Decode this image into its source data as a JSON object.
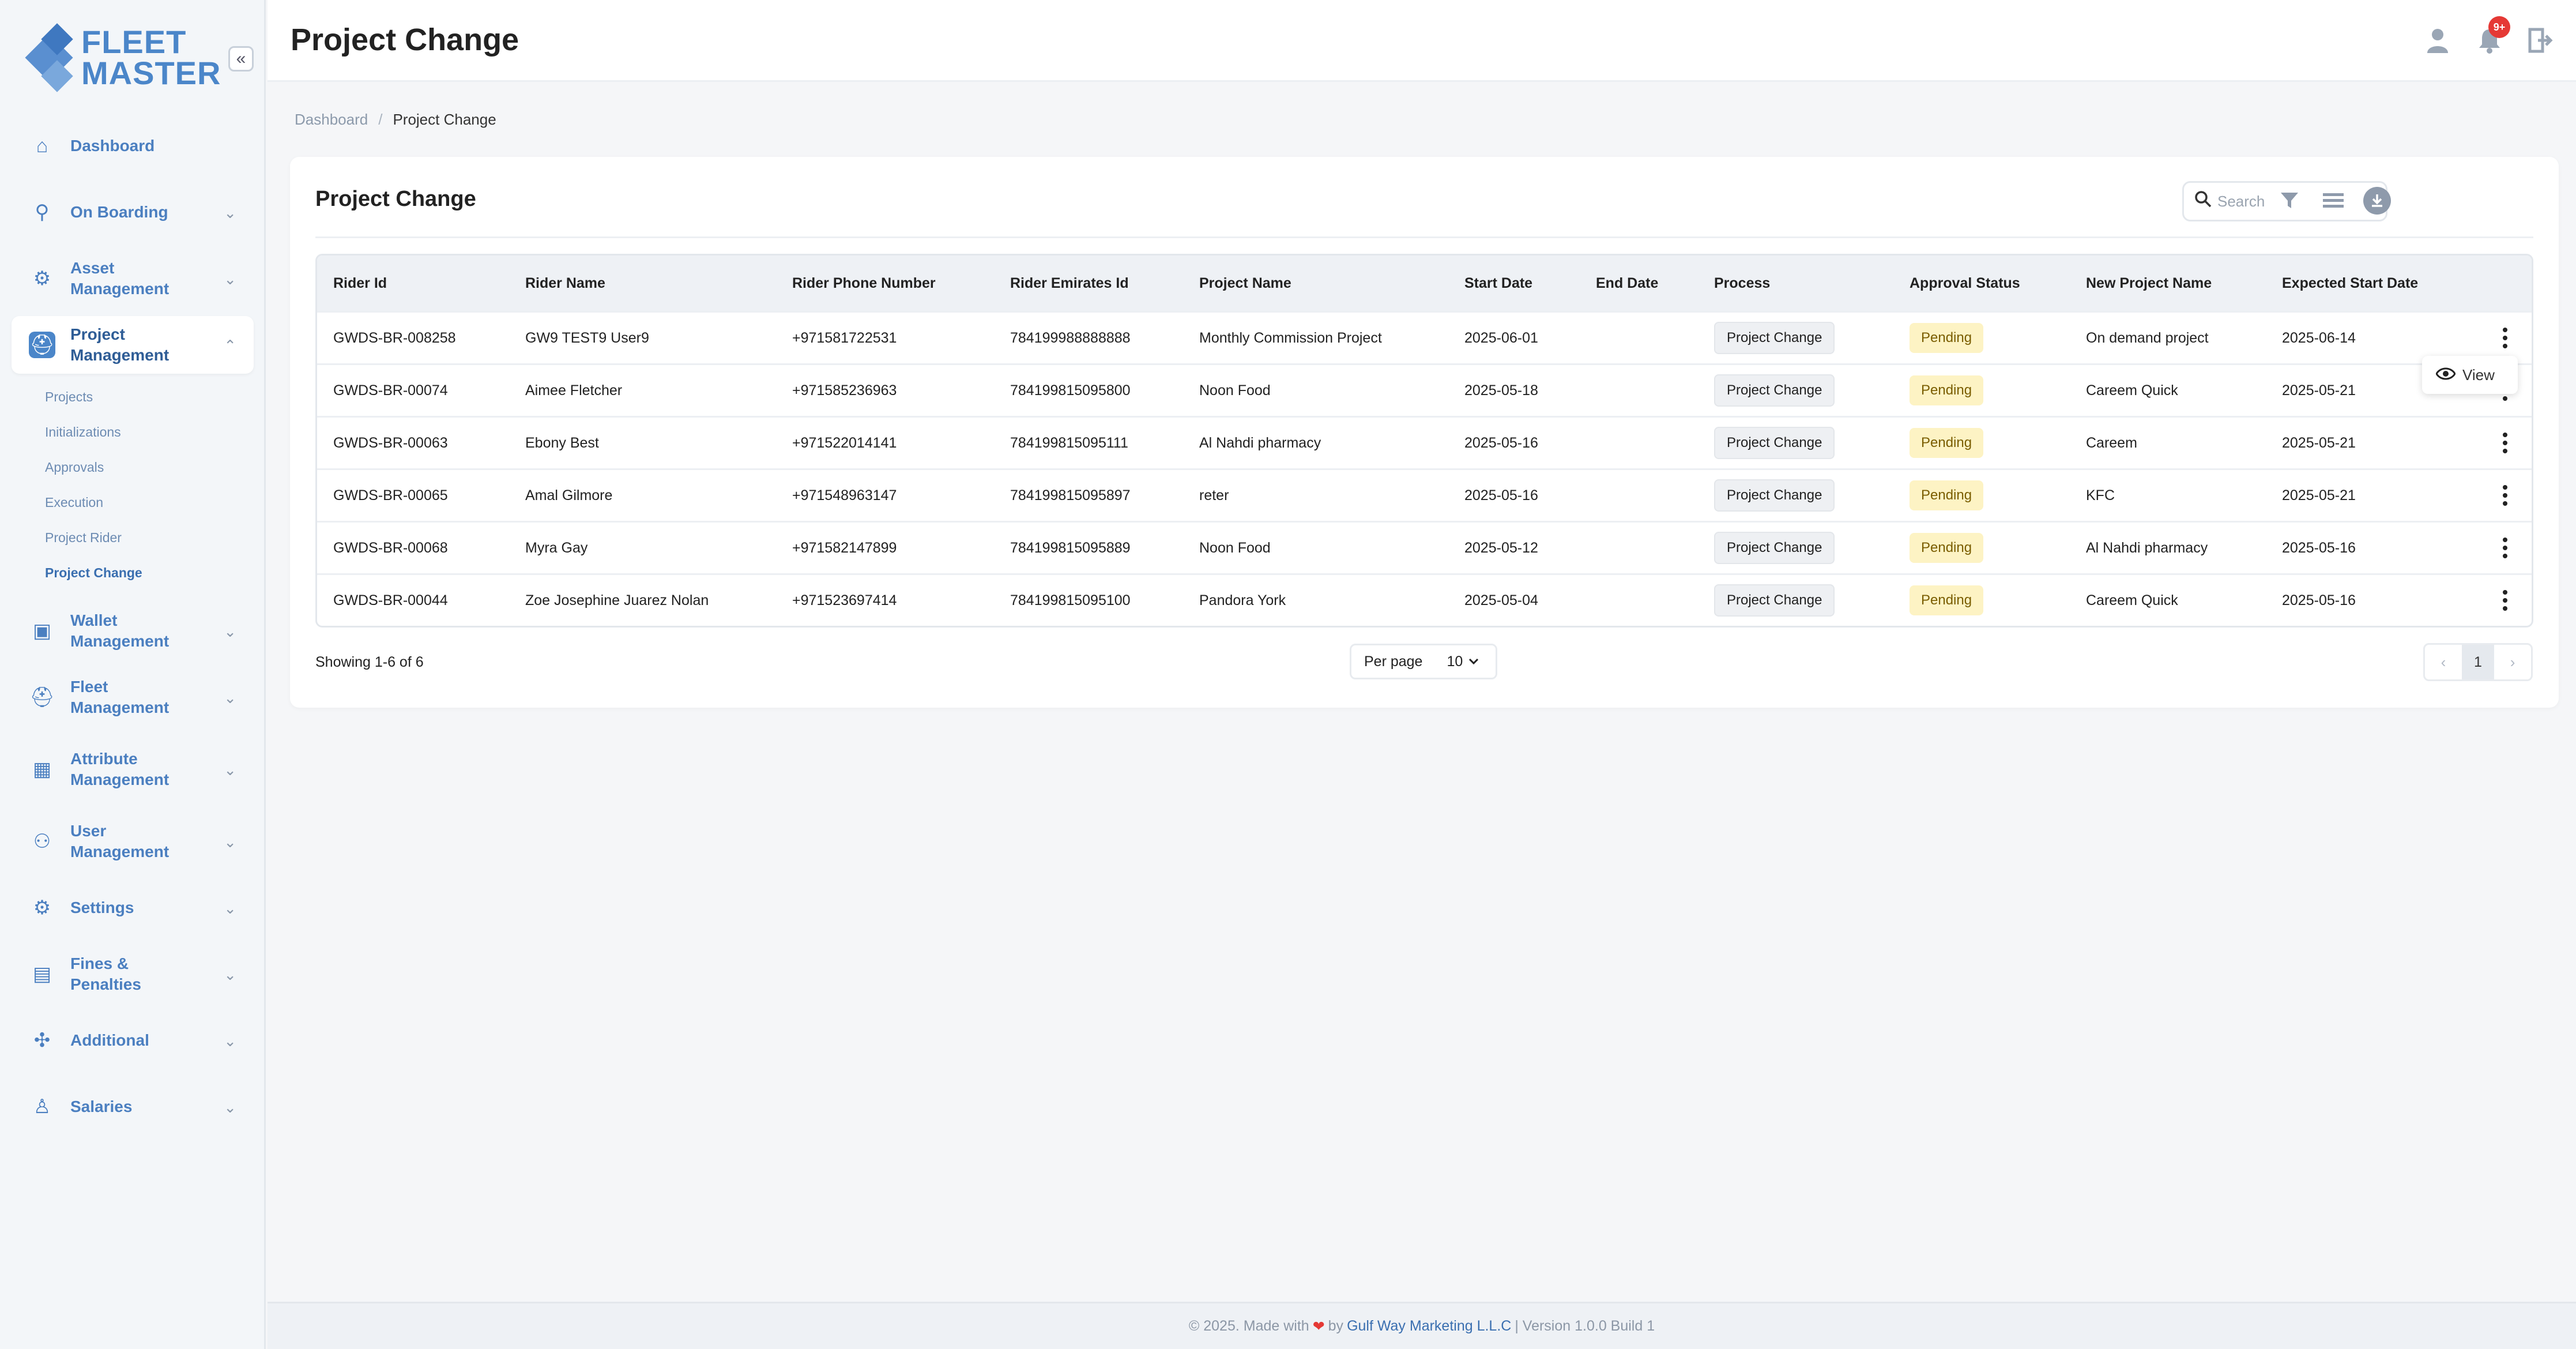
{
  "brand": {
    "line1": "FLEET",
    "line2": "MASTER",
    "collapse_icon": "«"
  },
  "sidebar": {
    "items": [
      {
        "label": "Dashboard",
        "icon": "home-icon",
        "glyph": "⌂",
        "chevron": ""
      },
      {
        "label": "On Boarding",
        "icon": "onboarding-icon",
        "glyph": "⚲",
        "chevron": "⌄"
      },
      {
        "label": "Asset Management",
        "icon": "asset-icon",
        "glyph": "⚙",
        "chevron": "⌄"
      },
      {
        "label": "Project Management",
        "icon": "project-icon",
        "glyph": "⛑",
        "chevron": "⌃"
      },
      {
        "label": "Wallet Management",
        "icon": "wallet-icon",
        "glyph": "▣",
        "chevron": "⌄"
      },
      {
        "label": "Fleet Management",
        "icon": "fleet-icon",
        "glyph": "⛑",
        "chevron": "⌄"
      },
      {
        "label": "Attribute Management",
        "icon": "attribute-icon",
        "glyph": "▦",
        "chevron": "⌄"
      },
      {
        "label": "User Management",
        "icon": "users-icon",
        "glyph": "⚇",
        "chevron": "⌄"
      },
      {
        "label": "Settings",
        "icon": "settings-icon",
        "glyph": "⚙",
        "chevron": "⌄"
      },
      {
        "label": "Fines & Penalties",
        "icon": "fines-icon",
        "glyph": "▤",
        "chevron": "⌄"
      },
      {
        "label": "Additional",
        "icon": "additional-icon",
        "glyph": "✣",
        "chevron": "⌄"
      },
      {
        "label": "Salaries",
        "icon": "salaries-icon",
        "glyph": "♙",
        "chevron": "⌄"
      }
    ],
    "submenu": [
      "Projects",
      "Initializations",
      "Approvals",
      "Execution",
      "Project Rider",
      "Project Change"
    ]
  },
  "header": {
    "title": "Project Change",
    "notification_badge": "9+",
    "user_icon": "user-icon",
    "bell_icon": "bell-icon",
    "logout_icon": "logout-icon"
  },
  "breadcrumb": {
    "home": "Dashboard",
    "separator": "/",
    "current": "Project Change"
  },
  "card": {
    "title": "Project Change",
    "search_placeholder": "Search",
    "search_glyph": "⚲",
    "filter_glyph": "⛛",
    "columns_glyph": "☰",
    "download_glyph": "⤓"
  },
  "table": {
    "columns": [
      "Rider Id",
      "Rider Name",
      "Rider Phone Number",
      "Rider Emirates Id",
      "Project Name",
      "Start Date",
      "End Date",
      "Process",
      "Approval Status",
      "New Project Name",
      "Expected Start Date"
    ],
    "rows": [
      [
        "GWDS-BR-008258",
        "GW9 TEST9 User9",
        "+971581722531",
        "784199988888888",
        "Monthly Commission Project",
        "2025-06-01",
        "",
        "Project Change",
        "Pending",
        "On demand project",
        "2025-06-14"
      ],
      [
        "GWDS-BR-00074",
        "Aimee Fletcher",
        "+971585236963",
        "784199815095800",
        "Noon Food",
        "2025-05-18",
        "",
        "Project Change",
        "Pending",
        "Careem Quick",
        "2025-05-21"
      ],
      [
        "GWDS-BR-00063",
        "Ebony Best",
        "+971522014141",
        "784199815095111",
        "Al Nahdi pharmacy",
        "2025-05-16",
        "",
        "Project Change",
        "Pending",
        "Careem",
        "2025-05-21"
      ],
      [
        "GWDS-BR-00065",
        "Amal Gilmore",
        "+971548963147",
        "784199815095897",
        "reter",
        "2025-05-16",
        "",
        "Project Change",
        "Pending",
        "KFC",
        "2025-05-21"
      ],
      [
        "GWDS-BR-00068",
        "Myra Gay",
        "+971582147899",
        "784199815095889",
        "Noon Food",
        "2025-05-12",
        "",
        "Project Change",
        "Pending",
        "Al Nahdi pharmacy",
        "2025-05-16"
      ],
      [
        "GWDS-BR-00044",
        "Zoe Josephine Juarez Nolan",
        "+971523697414",
        "784199815095100",
        "Pandora York",
        "2025-05-04",
        "",
        "Project Change",
        "Pending",
        "Careem Quick",
        "2025-05-16"
      ]
    ]
  },
  "row_menu": {
    "view_label": "View",
    "view_glyph": "◉"
  },
  "pagination": {
    "showing": "Showing 1-6 of 6",
    "per_page_label": "Per page",
    "per_page_value": "10",
    "current_page": "1",
    "prev": "‹",
    "next": "›"
  },
  "footer": {
    "prefix": "© 2025. Made with",
    "heart": "❤",
    "by": "by",
    "company": "Gulf Way Marketing L.L.C",
    "version": "| Version 1.0.0 Build 1"
  },
  "colors": {
    "accent": "#4b86c9",
    "pending_bg": "#fdf3c4",
    "badge": "#e53935"
  }
}
